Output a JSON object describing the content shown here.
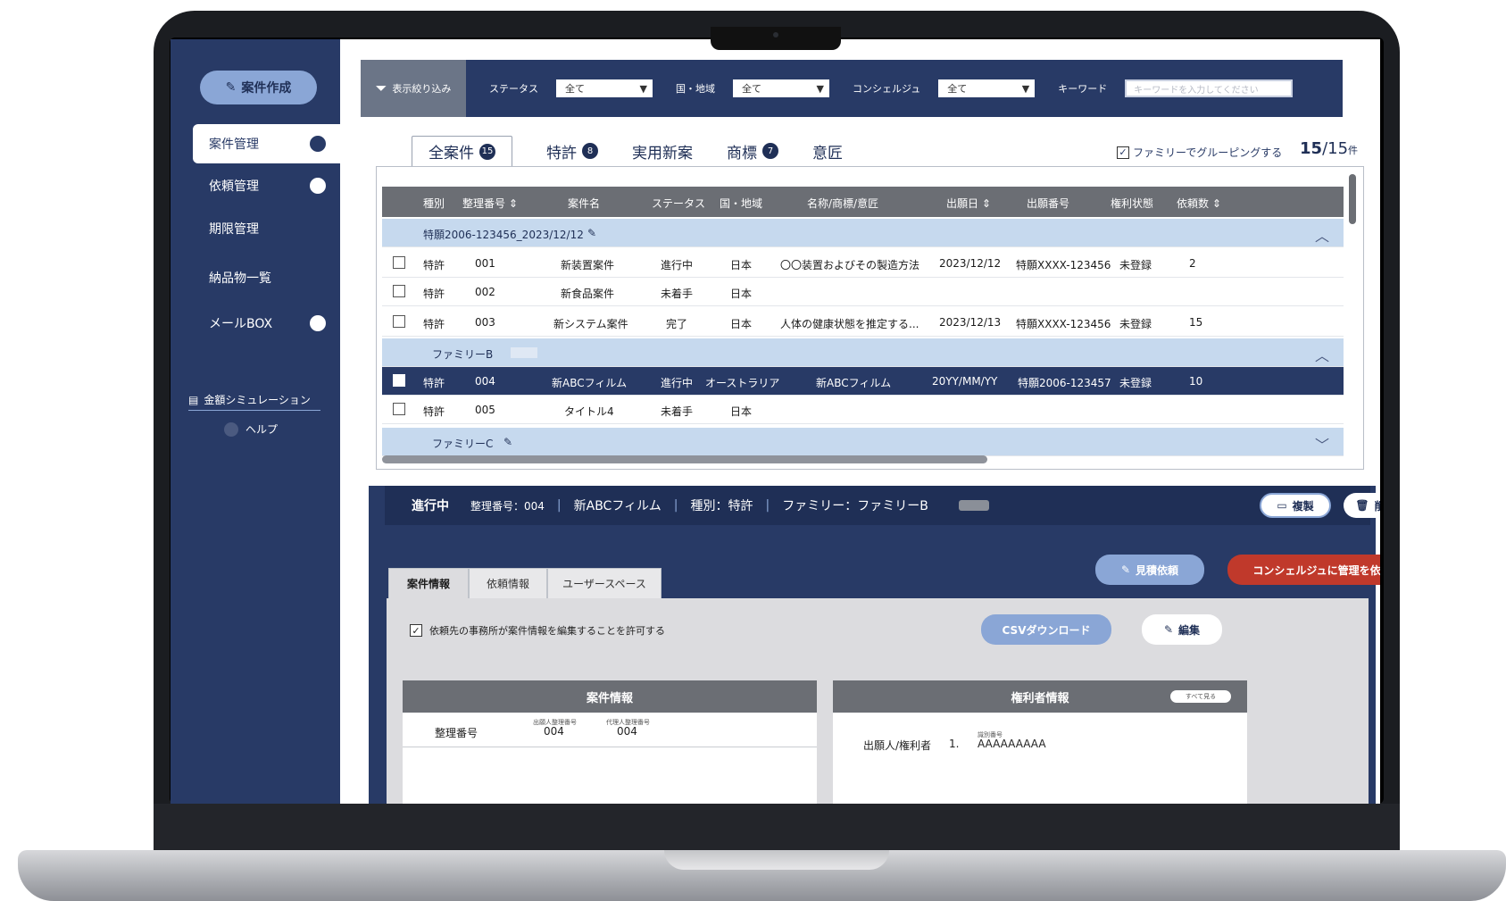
{
  "sidebar": {
    "create_button": "案件作成",
    "items": [
      {
        "label": "案件管理"
      },
      {
        "label": "依頼管理"
      },
      {
        "label": "期限管理"
      },
      {
        "label": "納品物一覧"
      },
      {
        "label": "メールBOX"
      }
    ],
    "simulation": "金額シミュレーション",
    "help": "ヘルプ"
  },
  "filter": {
    "toggle_label": "表示絞り込み",
    "status_label": "ステータス",
    "status_value": "全て",
    "country_label": "国・地域",
    "country_value": "全て",
    "concierge_label": "コンシェルジュ",
    "concierge_value": "全て",
    "keyword_label": "キーワード",
    "keyword_placeholder": "キーワードを入力してください"
  },
  "tabs": [
    {
      "label": "全案件",
      "badge": "15"
    },
    {
      "label": "特許",
      "badge": "8"
    },
    {
      "label": "実用新案",
      "badge": ""
    },
    {
      "label": "商標",
      "badge": "7"
    },
    {
      "label": "意匠",
      "badge": ""
    }
  ],
  "group_toggle": "ファミリーでグルーピングする",
  "count": {
    "shown": "15",
    "total": "/15",
    "unit": "件"
  },
  "table": {
    "columns": [
      "種別",
      "整理番号",
      "案件名",
      "ステータス",
      "国・地域",
      "名称/商標/意匠",
      "出願日",
      "出願番号",
      "権利状態",
      "依頼数"
    ],
    "group1": "特願2006-123456_2023/12/12",
    "group2": "ファミリーB",
    "group3": "ファミリーC",
    "rows": [
      {
        "type": "特許",
        "no": "001",
        "name": "新装置案件",
        "status": "進行中",
        "country": "日本",
        "title": "〇〇装置およびその製造方法",
        "date": "2023/12/12",
        "appno": "特願XXXX-123456",
        "right": "未登録",
        "req": "2"
      },
      {
        "type": "特許",
        "no": "002",
        "name": "新食品案件",
        "status": "未着手",
        "country": "日本",
        "title": "",
        "date": "",
        "appno": "",
        "right": "",
        "req": ""
      },
      {
        "type": "特許",
        "no": "003",
        "name": "新システム案件",
        "status": "完了",
        "country": "日本",
        "title": "人体の健康状態を推定する...",
        "date": "2023/12/13",
        "appno": "特願XXXX-123456",
        "right": "未登録",
        "req": "15"
      },
      {
        "type": "特許",
        "no": "004",
        "name": "新ABCフィルム",
        "status": "進行中",
        "country": "オーストラリア",
        "title": "新ABCフィルム",
        "date": "20YY/MM/YY",
        "appno": "特願2006-123457",
        "right": "未登録",
        "req": "10"
      },
      {
        "type": "特許",
        "no": "005",
        "name": "タイトル4",
        "status": "未着手",
        "country": "日本",
        "title": "",
        "date": "",
        "appno": "",
        "right": "",
        "req": ""
      }
    ]
  },
  "detail": {
    "status": "進行中",
    "no": "整理番号：004",
    "name": "新ABCフィルム",
    "kind": "種別：特許",
    "family": "ファミリー：ファミリーB",
    "copy_button": "複製",
    "delete_button": "削除",
    "estimate_button": "見積依頼",
    "concierge_button": "コンシェルジュに管理を依頼",
    "tabs": [
      "案件情報",
      "依頼情報",
      "ユーザースペース"
    ],
    "permit": "依頼先の事務所が案件情報を編集することを許可する",
    "csv_button": "CSVダウンロード",
    "edit_button": "編集",
    "case_info": {
      "title": "案件情報",
      "row_label": "整理番号",
      "applicant_no_label": "出願人整理番号",
      "applicant_no": "004",
      "agent_no_label": "代理人整理番号",
      "agent_no": "004"
    },
    "rights_info": {
      "title": "権利者情報",
      "see_all": "すべて見る",
      "row_label": "出願人/権利者",
      "index": "1.",
      "sub_label": "識別番号",
      "value": "AAAAAAAAA"
    }
  },
  "colors": {
    "navy": "#283a66",
    "accent_red": "#c0392b",
    "pill_blue": "#8aa6d6",
    "group_row": "#c6d9ee"
  }
}
